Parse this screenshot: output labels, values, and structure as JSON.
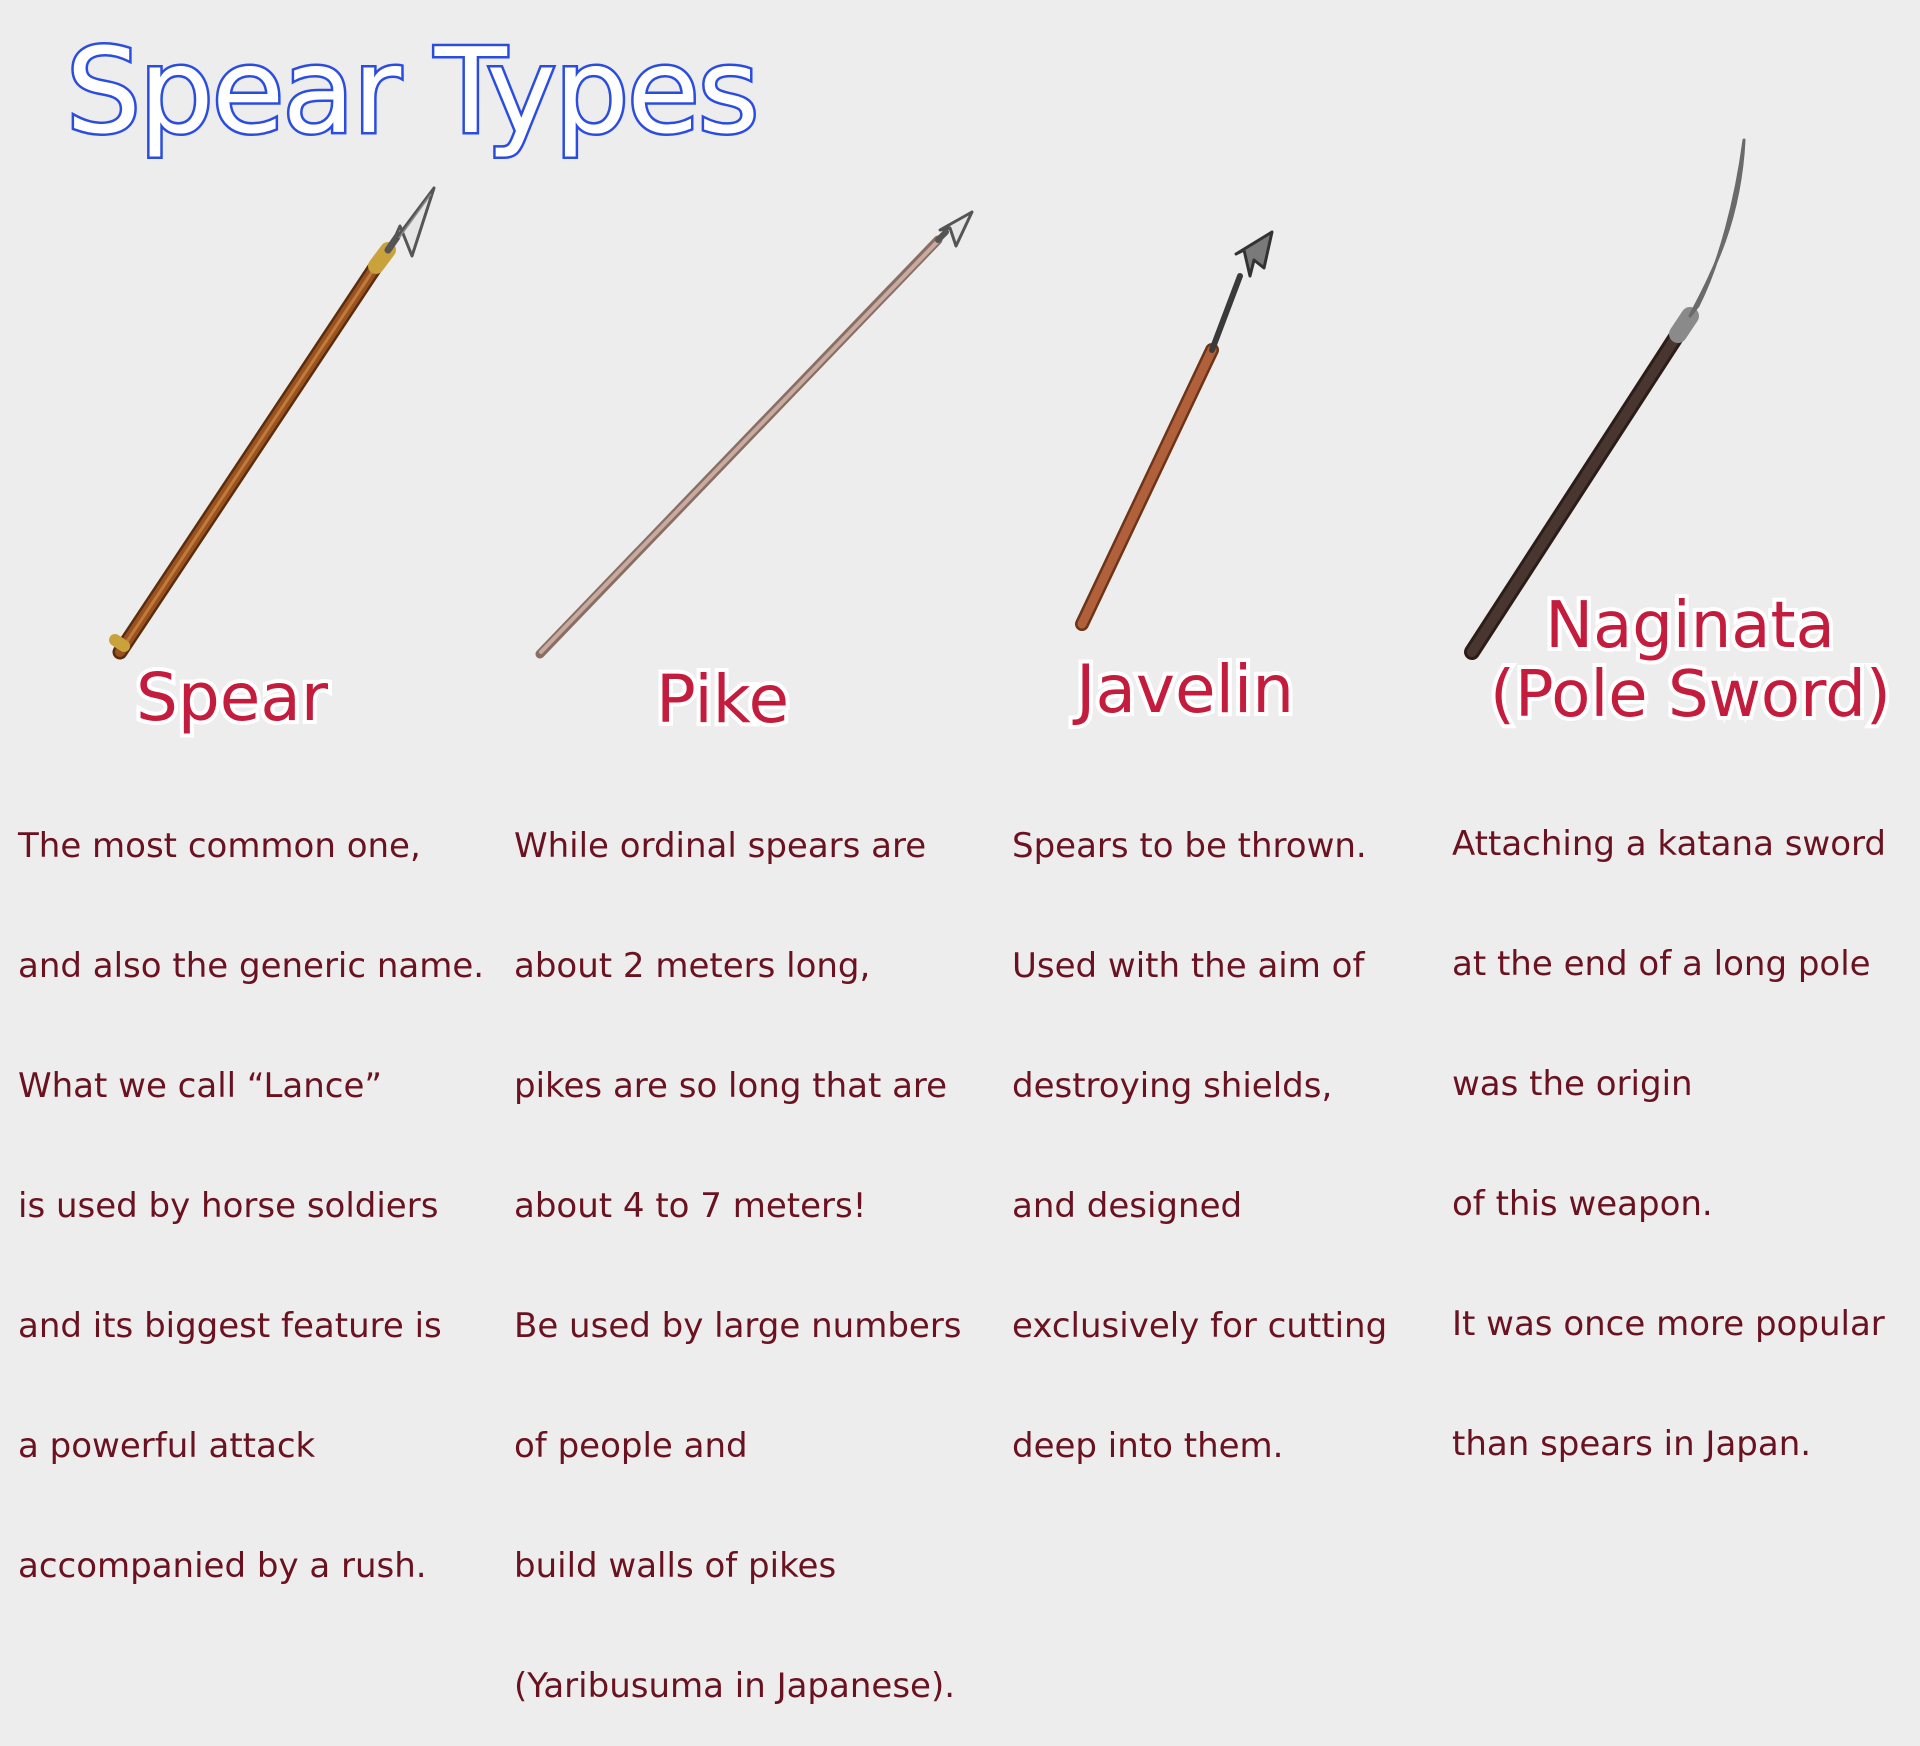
{
  "title": "Spear Types",
  "colors": {
    "background": "#ededed",
    "title_fill": "#ffffff",
    "title_outline": "#2b4ee0",
    "label": "#c41c3d",
    "description": "#6b1220"
  },
  "weapons": [
    {
      "id": "spear",
      "name_lines": [
        "Spear"
      ],
      "description_lines": [
        "The most common one,",
        "and also the generic name.",
        "What we call “Lance”",
        "is used by horse soldiers",
        "and its biggest feature is",
        "a powerful attack",
        "accompanied by a rush."
      ]
    },
    {
      "id": "pike",
      "name_lines": [
        "Pike"
      ],
      "description_lines": [
        "While ordinal spears are",
        "about 2 meters long,",
        "pikes are so long that are",
        "about 4 to 7 meters!",
        "Be used by large numbers",
        "of people and",
        "build walls of pikes",
        "(Yaribusuma in Japanese)."
      ]
    },
    {
      "id": "javelin",
      "name_lines": [
        "Javelin"
      ],
      "description_lines": [
        "Spears to be thrown.",
        "Used with the aim of",
        "destroying shields,",
        "and designed",
        "exclusively for cutting",
        "deep into them."
      ]
    },
    {
      "id": "naginata",
      "name_lines": [
        "Naginata",
        "(Pole Sword)"
      ],
      "description_lines": [
        "Attaching a katana sword",
        "at the end of a long pole",
        "was the origin",
        "of this weapon.",
        "It was once more popular",
        "than spears in Japan."
      ]
    }
  ]
}
